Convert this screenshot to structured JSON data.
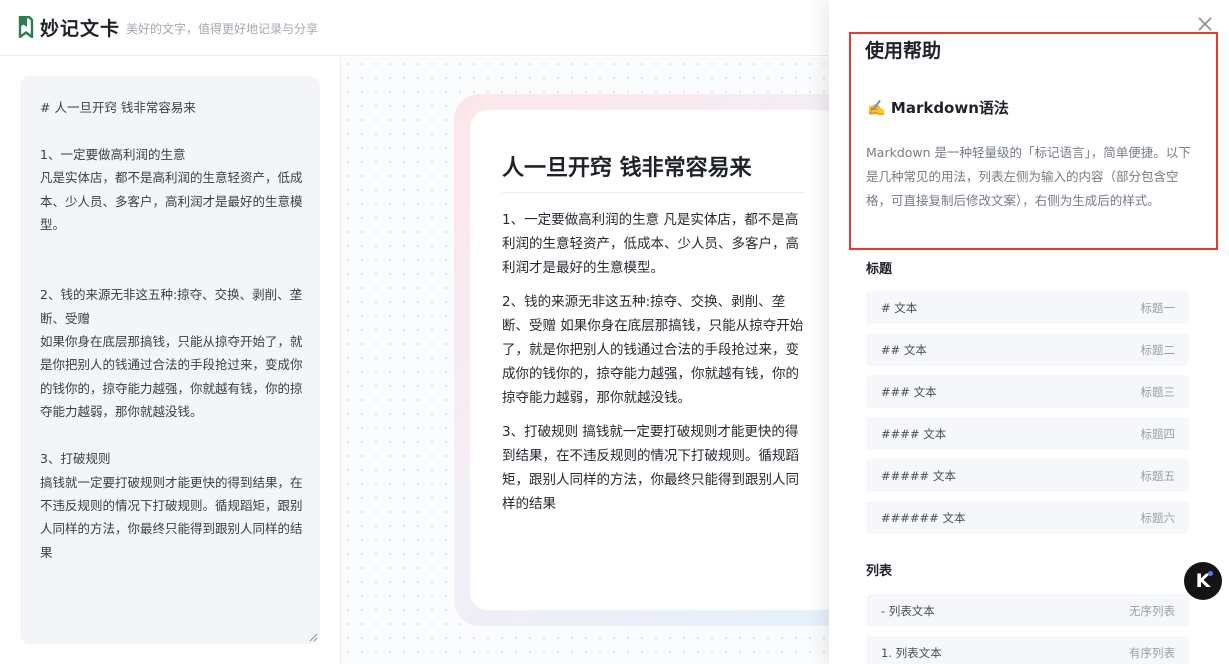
{
  "header": {
    "app_title": "妙记文卡",
    "slogan": "美好的文字，值得更好地记录与分享",
    "logo_icon": "bookmark-logo-icon",
    "brand_color": "#2e7d52"
  },
  "editor": {
    "content": "# 人一旦开窍 钱非常容易来\n\n1、一定要做高利润的生意\n凡是实体店，都不是高利润的生意轻资产，低成本、少人员、多客户，高利润才是最好的生意模型。\n\n\n2、钱的来源无非这五种:掠夺、交换、剥削、垄断、受赠\n如果你身在底层那搞钱，只能从掠夺开始了，就是你把别人的钱通过合法的手段抢过来，变成你的钱你的，掠夺能力越强，你就越有钱，你的掠夺能力越弱，那你就越没钱。\n\n3、打破规则\n搞钱就一定要打破规则才能更快的得到结果，在不违反规则的情况下打破规则。循规蹈矩，跟别人同样的方法，你最终只能得到跟别人同样的结果"
  },
  "card": {
    "title": "人一旦开窍 钱非常容易来",
    "paragraphs": [
      "1、一定要做高利润的生意 凡是实体店，都不是高利润的生意轻资产，低成本、少人员、多客户，高利润才是最好的生意模型。",
      "2、钱的来源无非这五种:掠夺、交换、剥削、垄断、受赠 如果你身在底层那搞钱，只能从掠夺开始了，就是你把别人的钱通过合法的手段抢过来，变成你的钱你的，掠夺能力越强，你就越有钱，你的掠夺能力越弱，那你就越没钱。",
      "3、打破规则 搞钱就一定要打破规则才能更快的得到结果，在不违反规则的情况下打破规则。循规蹈矩，跟别人同样的方法，你最终只能得到跟别人同样的结果"
    ]
  },
  "help": {
    "title": "使用帮助",
    "close_icon": "close-icon",
    "highlight_color": "#e53935",
    "markdown_heading": "✍️ Markdown语法",
    "markdown_desc": "Markdown 是一种轻量级的「标记语言」，简单便捷。以下是几种常见的用法，列表左侧为输入的内容（部分包含空格，可直接复制后修改文案），右侧为生成后的样式。",
    "heading_section": {
      "title": "标题",
      "rows": [
        {
          "input": "# 文本",
          "output": "标题一"
        },
        {
          "input": "## 文本",
          "output": "标题二"
        },
        {
          "input": "### 文本",
          "output": "标题三"
        },
        {
          "input": "#### 文本",
          "output": "标题四"
        },
        {
          "input": "##### 文本",
          "output": "标题五"
        },
        {
          "input": "###### 文本",
          "output": "标题六"
        }
      ]
    },
    "list_section": {
      "title": "列表",
      "rows": [
        {
          "input": "- 列表文本",
          "output": "无序列表"
        },
        {
          "input": "1. 列表文本",
          "output": "有序列表"
        }
      ]
    }
  },
  "float_badge": {
    "label": "K",
    "icon": "assistant-badge-icon"
  }
}
